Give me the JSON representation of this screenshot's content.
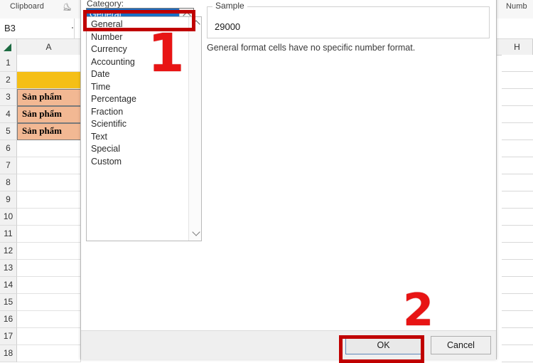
{
  "app": {
    "ribbon": {
      "clipboard_group": "Clipboard",
      "number_group": "Numb",
      "dialog_launcher_icon": "dialog-launcher-icon"
    },
    "name_box": {
      "value": "B3"
    },
    "grid": {
      "select_all_icon": "select-all-triangle-icon",
      "columns": [
        "A",
        "H"
      ],
      "rows": [
        "1",
        "2",
        "3",
        "4",
        "5",
        "6",
        "7",
        "8",
        "9",
        "10",
        "11",
        "12",
        "13",
        "14",
        "15",
        "16",
        "17",
        "18"
      ],
      "cells": [
        {
          "row": "2",
          "text": "",
          "fill": "#f5bf16"
        },
        {
          "row": "3",
          "text": "Sản phẩm",
          "fill": "#f2b893"
        },
        {
          "row": "4",
          "text": "Sản phẩm",
          "fill": "#f2b893"
        },
        {
          "row": "5",
          "text": "Sản phẩm",
          "fill": "#f2b893"
        }
      ]
    }
  },
  "dialog": {
    "category_label": "Category:",
    "combo": {
      "selected": "General",
      "arrow_icon": "chevron-up-icon"
    },
    "category_items": [
      "General",
      "Number",
      "Currency",
      "Accounting",
      "Date",
      "Time",
      "Percentage",
      "Fraction",
      "Scientific",
      "Text",
      "Special",
      "Custom"
    ],
    "scrollbar": {
      "up_icon": "scroll-up-arrow-icon",
      "down_icon": "scroll-down-arrow-icon"
    },
    "sample": {
      "legend": "Sample",
      "value": "29000"
    },
    "format_description": "General format cells have no specific number format.",
    "buttons": {
      "ok": "OK",
      "cancel": "Cancel"
    }
  },
  "annotations": {
    "step_one": "1",
    "step_two": "2",
    "color": "#c00000"
  }
}
